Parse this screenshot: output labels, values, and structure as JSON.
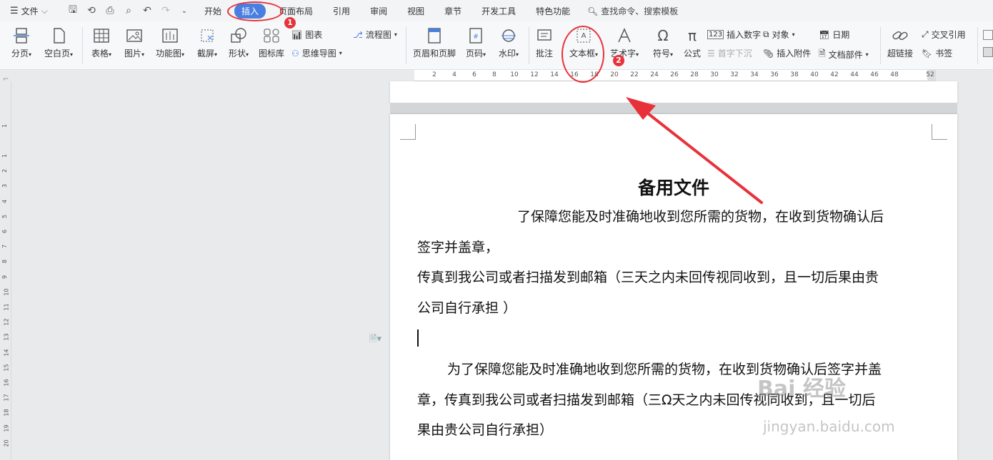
{
  "menubar": {
    "file_label": "文件",
    "tabs": [
      "开始",
      "插入",
      "页面布局",
      "引用",
      "审阅",
      "视图",
      "章节",
      "开发工具",
      "特色功能"
    ],
    "active_tab": "插入",
    "search_placeholder": "查找命令、搜索模板"
  },
  "ribbon": {
    "page_break": "分页",
    "blank_page": "空白页",
    "table": "表格",
    "picture": "图片",
    "function_chart": "功能图",
    "screenshot": "截屏",
    "shape": "形状",
    "icon_lib": "图标库",
    "chart": "图表",
    "mindmap": "思维导图",
    "flowchart": "流程图",
    "header_footer": "页眉和页脚",
    "page_number": "页码",
    "watermark": "水印",
    "comment": "批注",
    "textbox": "文本框",
    "wordart": "艺术字",
    "symbol": "符号",
    "formula": "公式",
    "insert_number": "插入数字",
    "drop_cap": "首字下沉",
    "object": "对象",
    "attachment": "插入附件",
    "date": "日期",
    "doc_parts": "文档部件",
    "hyperlink": "超链接",
    "cross_ref": "交叉引用",
    "bookmark": "书签"
  },
  "ruler": {
    "h_numbers": [
      "2",
      "4",
      "6",
      "8",
      "10",
      "12",
      "14",
      "16",
      "18",
      "20",
      "22",
      "24",
      "26",
      "28",
      "30",
      "32",
      "34",
      "36",
      "38",
      "40",
      "42",
      "44",
      "46",
      "48",
      "52"
    ],
    "v_numbers": [
      "1",
      "1",
      "2",
      "3",
      "4",
      "5",
      "6",
      "7",
      "8",
      "9",
      "10",
      "11",
      "12",
      "13",
      "14",
      "15",
      "16",
      "17",
      "18",
      "19",
      "20"
    ]
  },
  "document": {
    "title": "备用文件",
    "p1_line1": "了保障您能及时准确地收到您所需的货物，在收到货物确认后",
    "p1_line2": "签字并盖章，",
    "p2_line1": "传真到我公司或者扫描发到邮箱（三天之内未回传视同收到，且一切后果由贵",
    "p2_line2": "公司自行承担 ）",
    "p3_line1": "为了保障您能及时准确地收到您所需的货物，在收到货物确认后签字并盖",
    "p3_line2": "章，传真到我公司或者扫描发到邮箱（三Ω天之内未回传视同收到，且一切后",
    "p3_line3": "果由贵公司自行承担）"
  },
  "annotations": {
    "badge1": "1",
    "badge2": "2",
    "accent_color": "#e8323a"
  },
  "watermark": {
    "brand": "Bai 经验",
    "url": "jingyan.baidu.com"
  }
}
